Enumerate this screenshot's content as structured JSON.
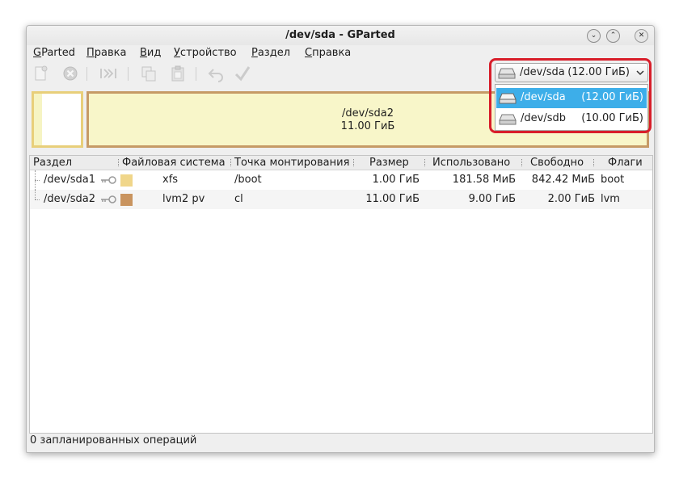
{
  "window": {
    "title": "/dev/sda - GParted"
  },
  "menubar": {
    "items": [
      {
        "label": "GParted",
        "mnemonic": "G",
        "rest": "Parted"
      },
      {
        "label": "Правка",
        "mnemonic": "П",
        "rest": "равка"
      },
      {
        "label": "Вид",
        "mnemonic": "В",
        "rest": "ид"
      },
      {
        "label": "Устройство",
        "mnemonic": "У",
        "rest": "стройство"
      },
      {
        "label": "Раздел",
        "mnemonic": "Р",
        "rest": "аздел"
      },
      {
        "label": "Справка",
        "mnemonic": "С",
        "rest": "правка"
      }
    ]
  },
  "toolbar": {
    "icons": [
      "new-icon",
      "delete-icon",
      "resize-move-icon",
      "copy-icon",
      "paste-icon",
      "undo-icon",
      "apply-icon"
    ]
  },
  "diskmap": {
    "partition2_name": "/dev/sda2",
    "partition2_size": "11.00 ГиБ"
  },
  "device_selector": {
    "current_name": "/dev/sda",
    "current_size": "(12.00 ГиБ)",
    "options": [
      {
        "name": "/dev/sda",
        "size": "(12.00 ГиБ)",
        "selected": true
      },
      {
        "name": "/dev/sdb",
        "size": "(10.00 ГиБ)",
        "selected": false
      }
    ]
  },
  "table": {
    "headers": [
      "Раздел",
      "Файловая система",
      "Точка монтирования",
      "Размер",
      "Использовано",
      "Свободно",
      "Флаги"
    ],
    "rows": [
      {
        "partition": "/dev/sda1",
        "filesystem": "xfs",
        "fs_color": "#f0d68a",
        "mount": "/boot",
        "size": "1.00 ГиБ",
        "used": "181.58 МиБ",
        "free": "842.42 МиБ",
        "flags": "boot"
      },
      {
        "partition": "/dev/sda2",
        "filesystem": "lvm2 pv",
        "fs_color": "#c9945f",
        "mount": "cl",
        "size": "11.00 ГиБ",
        "used": "9.00 ГиБ",
        "free": "2.00 ГиБ",
        "flags": "lvm"
      }
    ]
  },
  "status": {
    "text": "0 запланированных операций"
  },
  "colors": {
    "highlight": "#d81e2a",
    "selection": "#3daee9"
  }
}
